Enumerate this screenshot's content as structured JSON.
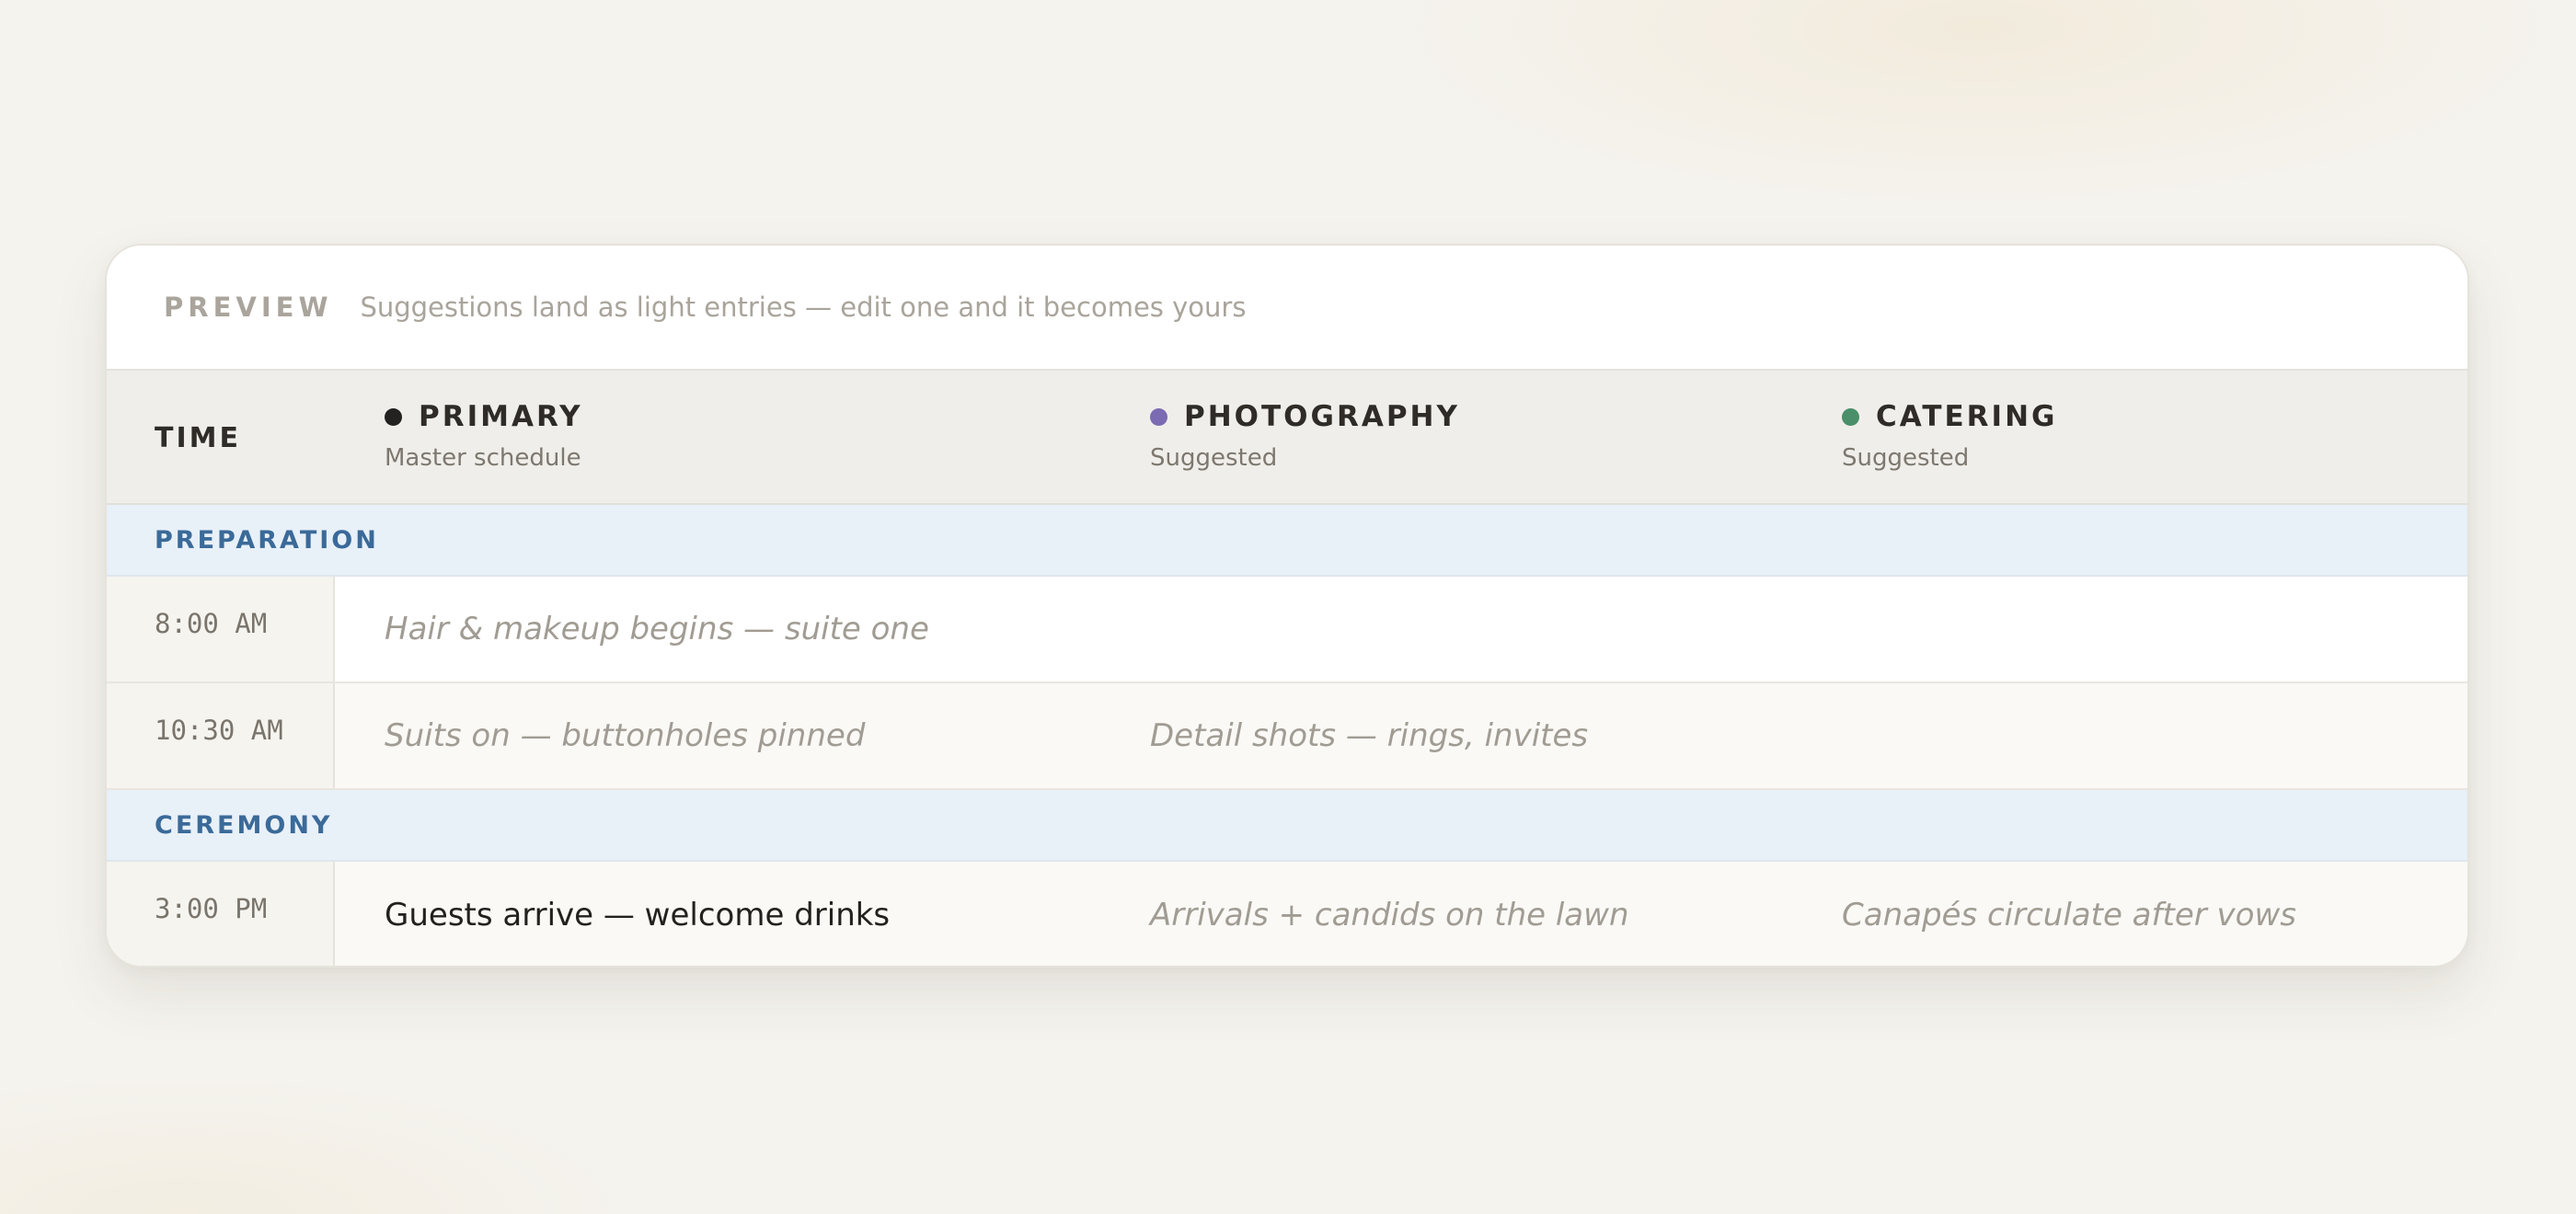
{
  "preview": {
    "tag": "PREVIEW",
    "text": "Suggestions land as light entries — edit one and it becomes yours"
  },
  "header": {
    "time_label": "TIME",
    "columns": [
      {
        "name": "PRIMARY",
        "sub": "Master schedule",
        "color": "#232220"
      },
      {
        "name": "PHOTOGRAPHY",
        "sub": "Suggested",
        "color": "#7b6bb2"
      },
      {
        "name": "CATERING",
        "sub": "Suggested",
        "color": "#4a8f6a"
      }
    ]
  },
  "sections": [
    {
      "label": "PREPARATION",
      "rows": [
        {
          "time": "8:00 AM",
          "primary": "Hair & makeup begins — suite one",
          "photography": "",
          "catering": ""
        },
        {
          "time": "10:30 AM",
          "primary": "Suits on — buttonholes pinned",
          "photography": "Detail shots — rings, invites",
          "catering": ""
        }
      ]
    },
    {
      "label": "CEREMONY",
      "rows": [
        {
          "time": "3:00 PM",
          "primary": "Guests arrive — welcome drinks",
          "photography": "Arrivals + candids on the lawn",
          "catering": "Canapés circulate after vows"
        }
      ]
    }
  ]
}
